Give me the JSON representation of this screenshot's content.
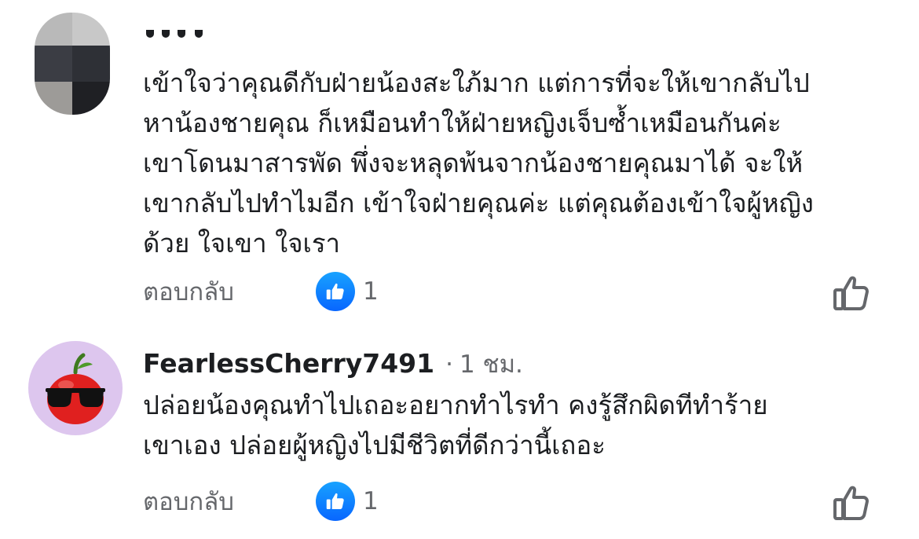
{
  "comments": [
    {
      "author": "",
      "text_lines": [
        "เข้าใจว่าคุณดีกับฝ่ายน้องสะใภ้มาก แต่การที่จะให้เขากลับไป",
        "หาน้องชายคุณ ก็เหมือนทำให้ฝ่ายหญิงเจ็บซ้ำเหมือนกันค่ะ",
        "เขาโดนมาสารพัด พึ่งจะหลุดพ้นจากน้องชายคุณมาได้ จะให้",
        "เขากลับไปทำไมอีก เข้าใจฝ่ายคุณค่ะ แต่คุณต้องเข้าใจผู้หญิง",
        "ด้วย ใจเขา ใจเรา"
      ],
      "reply_label": "ตอบกลับ",
      "reaction_count": "1",
      "reaction_icon": "thumbs-up-reaction-icon",
      "like_icon": "thumbs-up-outline-icon"
    },
    {
      "author": "FearlessCherry7491",
      "separator": "·",
      "timestamp": "1 ชม.",
      "text_lines": [
        "ปล่อยน้องคุณทำไปเถอะอยากทำไรทำ คงรู้สึกผิดทีทำร้าย",
        "เขาเอง ปล่อยผู้หญิงไปมีชีวิตที่ดีกว่านี้เถอะ"
      ],
      "reply_label": "ตอบกลับ",
      "reaction_count": "1",
      "reaction_icon": "thumbs-up-reaction-icon",
      "like_icon": "thumbs-up-outline-icon"
    }
  ],
  "colors": {
    "text_primary": "#1c1e21",
    "text_secondary": "#65676b",
    "reaction_blue": "#0866ff",
    "avatar_bg_cherry": "#ddc6ee",
    "cherry_red": "#e0201f"
  }
}
